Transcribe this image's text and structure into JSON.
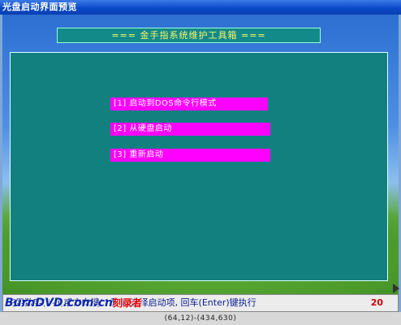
{
  "window": {
    "title": "光盘启动界面预览"
  },
  "banner": {
    "text": "=== 金手指系统维护工具箱 ==="
  },
  "menu": {
    "items": [
      {
        "label": "[1] 启动到DOS命令行模式"
      },
      {
        "label": "[2] 从硬盘启动"
      },
      {
        "label": "[3] 重新启动"
      }
    ]
  },
  "statusbar": {
    "text": "使用数字(1-3)或方向键(↑和↓)选择启动项, 回车(Enter)键执行",
    "countdown": "20"
  },
  "coords": {
    "text": "(64,12)-(434,630)"
  },
  "watermark": {
    "brand": "BurnDVD",
    "domain": ".com.cn",
    "cn": "刻录者"
  },
  "colors": {
    "panel": "#138080",
    "menu_highlight": "#ff00ff",
    "banner_text": "#f7f766",
    "status_number": "#cc0000"
  }
}
